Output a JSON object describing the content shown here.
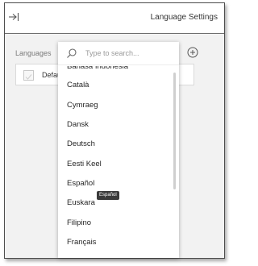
{
  "header": {
    "title": "Language Settings",
    "collapse_icon": "collapse-panel-icon"
  },
  "panel": {
    "languages_label": "Languages",
    "add_icon": "add-circle-icon",
    "row": {
      "label": "Default",
      "checked": false
    }
  },
  "dropdown": {
    "search_placeholder": "Type to search...",
    "search_value": "",
    "search_icon": "search-icon",
    "options": [
      "Bahasa Indonesia",
      "Català",
      "Cymraeg",
      "Dansk",
      "Deutsch",
      "Eesti Keel",
      "Español",
      "Euskara",
      "Filipino",
      "Français"
    ],
    "tooltip": "Español"
  },
  "colors": {
    "panel_bg": "#f2f2f2",
    "header_bg": "#ffffff",
    "tooltip_bg": "#3a3a3a",
    "text": "#262626"
  }
}
